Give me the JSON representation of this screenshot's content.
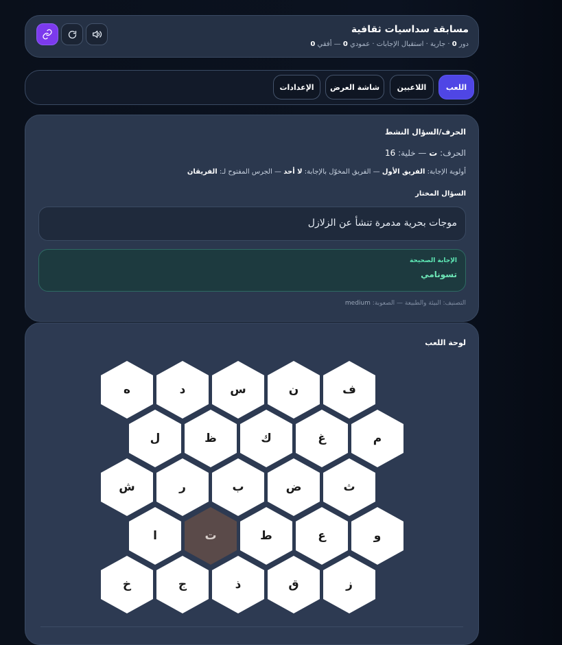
{
  "header": {
    "title": "مسابقة سداسيات ثقافية",
    "status": {
      "prefix": "دور",
      "round": "0",
      "sep1": "· جارية · استقبال الإجابات · عمودي",
      "vertical": "0",
      "sep2": "— أفقي",
      "horizontal": "0"
    },
    "icons": [
      "link-icon",
      "refresh-icon",
      "sound-icon"
    ]
  },
  "tabs": [
    {
      "label": "اللعب",
      "active": true
    },
    {
      "label": "اللاعبين",
      "active": false
    },
    {
      "label": "شاشة العرض",
      "active": false
    },
    {
      "label": "الإعدادات",
      "active": false
    }
  ],
  "active_question": {
    "heading": "الحرف/السؤال النشط",
    "letter_prefix": "الحرف:",
    "letter": "ت",
    "cell_prefix": "— خلية:",
    "cell": "16",
    "priority_prefix": "أولوية الإجابة:",
    "priority_team": "الفريق الأول",
    "authorized_prefix": "— الفريق المخوّل بالإجابة:",
    "authorized_team": "لا أحد",
    "bell_prefix": "— الجرس المفتوح لـ:",
    "bell_team": "الفريقان",
    "selected_label": "السؤال المختار",
    "question": "موجات بحرية مدمرة تنشأ عن الزلازل",
    "answer_label": "الإجابة الصحيحة",
    "answer": "تسونامي",
    "category_prefix": "التصنيف:",
    "category": "البيئة والطبيعة",
    "difficulty_prefix": "— الصعوبة:",
    "difficulty": "medium"
  },
  "board": {
    "heading": "لوحة اللعب",
    "rows": [
      [
        "ف",
        "ن",
        "س",
        "د",
        "ه"
      ],
      [
        "م",
        "غ",
        "ك",
        "ظ",
        "ل"
      ],
      [
        "ث",
        "ض",
        "ب",
        "ر",
        "ش"
      ],
      [
        "و",
        "ع",
        "ط",
        "ت",
        "ا"
      ],
      [
        "ز",
        "ق",
        "ذ",
        "ج",
        "خ"
      ]
    ],
    "selected": "ت",
    "colors": {
      "cell": "#ffffff",
      "selected": "#5a4a49",
      "background": "#2d3a52"
    }
  },
  "colors": {
    "accent": "#4f46e5",
    "link_button": "#7c3aed",
    "answer": "#6ee7b7"
  }
}
